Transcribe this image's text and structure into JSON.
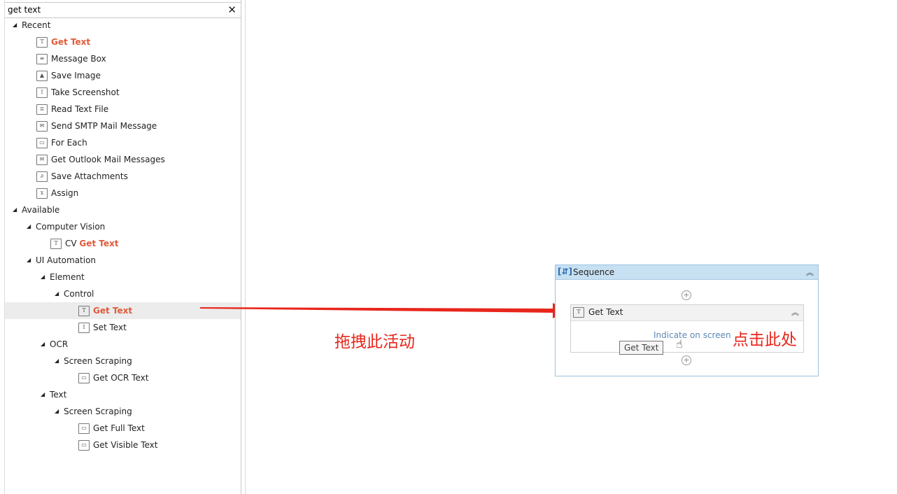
{
  "search": {
    "value": "get text",
    "clear_icon": "close-icon"
  },
  "tree": [
    {
      "depth": 0,
      "type": "group",
      "label": "Recent"
    },
    {
      "depth": 1,
      "type": "leaf",
      "icon": "get-text-icon",
      "glyph": "T",
      "prefix": "",
      "match": "Get Text"
    },
    {
      "depth": 1,
      "type": "leaf",
      "icon": "message-box-icon",
      "glyph": "≡",
      "prefix": "Message Box",
      "match": ""
    },
    {
      "depth": 1,
      "type": "leaf",
      "icon": "save-image-icon",
      "glyph": "▲",
      "prefix": "Save Image",
      "match": ""
    },
    {
      "depth": 1,
      "type": "leaf",
      "icon": "screenshot-icon",
      "glyph": "↕",
      "prefix": "Take Screenshot",
      "match": ""
    },
    {
      "depth": 1,
      "type": "leaf",
      "icon": "read-text-file-icon",
      "glyph": "≣",
      "prefix": "Read Text File",
      "match": ""
    },
    {
      "depth": 1,
      "type": "leaf",
      "icon": "mail-icon",
      "glyph": "✉",
      "prefix": "Send SMTP Mail Message",
      "match": ""
    },
    {
      "depth": 1,
      "type": "leaf",
      "icon": "for-each-icon",
      "glyph": "▭",
      "prefix": "For Each",
      "match": ""
    },
    {
      "depth": 1,
      "type": "leaf",
      "icon": "outlook-mail-icon",
      "glyph": "✉",
      "prefix": "Get Outlook Mail Messages",
      "match": ""
    },
    {
      "depth": 1,
      "type": "leaf",
      "icon": "attachment-icon",
      "glyph": "∂",
      "prefix": "Save Attachments",
      "match": ""
    },
    {
      "depth": 1,
      "type": "leaf",
      "icon": "assign-icon",
      "glyph": "x",
      "prefix": "Assign",
      "match": ""
    },
    {
      "depth": 0,
      "type": "group",
      "label": "Available"
    },
    {
      "depth": 1,
      "type": "group",
      "label": "Computer Vision"
    },
    {
      "depth": 2,
      "type": "leaf",
      "icon": "cv-get-text-icon",
      "glyph": "T",
      "prefix": "CV ",
      "match": "Get Text"
    },
    {
      "depth": 1,
      "type": "group",
      "label": "UI Automation"
    },
    {
      "depth": 2,
      "type": "group",
      "label": "Element"
    },
    {
      "depth": 3,
      "type": "group",
      "label": "Control"
    },
    {
      "depth": 4,
      "type": "leaf",
      "icon": "get-text-icon",
      "glyph": "T",
      "prefix": "",
      "match": "Get Text",
      "selected": true
    },
    {
      "depth": 4,
      "type": "leaf",
      "icon": "set-text-icon",
      "glyph": "I",
      "prefix": "Set Text",
      "match": ""
    },
    {
      "depth": 2,
      "type": "group",
      "label": "OCR"
    },
    {
      "depth": 3,
      "type": "group",
      "label": "Screen Scraping"
    },
    {
      "depth": 4,
      "type": "leaf",
      "icon": "screen-icon",
      "glyph": "▭",
      "prefix": "Get OCR Text",
      "match": ""
    },
    {
      "depth": 2,
      "type": "group",
      "label": "Text"
    },
    {
      "depth": 3,
      "type": "group",
      "label": "Screen Scraping"
    },
    {
      "depth": 4,
      "type": "leaf",
      "icon": "screen-icon",
      "glyph": "▭",
      "prefix": "Get Full Text",
      "match": ""
    },
    {
      "depth": 4,
      "type": "leaf",
      "icon": "screen-icon",
      "glyph": "▭",
      "prefix": "Get Visible Text",
      "match": ""
    }
  ],
  "designer": {
    "sequence_title": "Sequence",
    "activity_title": "Get Text",
    "indicate_link": "Indicate on screen",
    "tooltip": "Get Text"
  },
  "annotations": {
    "drag": "拖拽此活动",
    "click": "点击此处",
    "color": "#e8261c"
  },
  "colors": {
    "match_highlight": "#e05a3a",
    "sequence_header": "#c7e0f2",
    "link": "#5b87b5"
  }
}
